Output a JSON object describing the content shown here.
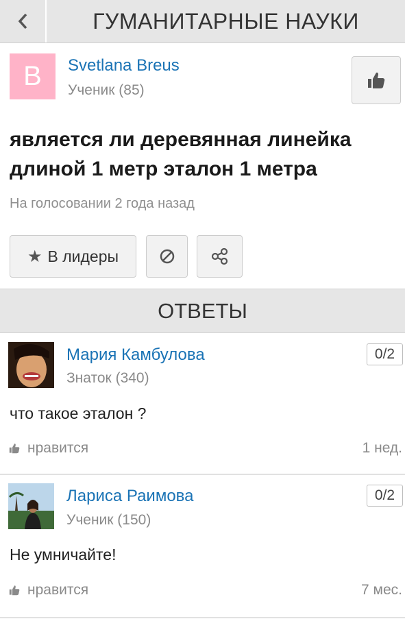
{
  "header": {
    "back_icon": "chevron-left-icon",
    "title": "ГУМАНИТАРНЫЕ НАУКИ"
  },
  "question": {
    "author": {
      "avatar_letter": "B",
      "avatar_color": "#ffb3c8",
      "name": "Svetlana Breus",
      "rank": "Ученик (85)"
    },
    "like_icon": "thumbs-up-icon",
    "text": "является ли деревянная линейка длиной 1 метр эталон 1 метра",
    "status": "На голосовании 2 года назад",
    "actions": {
      "leaders_label": "В лидеры",
      "leaders_icon": "star-icon",
      "block_icon": "block-icon",
      "share_icon": "share-icon"
    }
  },
  "answers_title": "ОТВЕТЫ",
  "answers": [
    {
      "name": "Мария Камбулова",
      "rank": "Знаток (340)",
      "score": "0/2",
      "text": "что такое эталон ?",
      "like_label": "нравится",
      "time": "1 нед."
    },
    {
      "name": "Лариса Раимова",
      "rank": "Ученик (150)",
      "score": "0/2",
      "text": "Не умничайте!",
      "like_label": "нравится",
      "time": "7 мес."
    }
  ],
  "colors": {
    "link": "#1a73b5",
    "header_bg": "#e6e6e6",
    "muted": "#8a8a8a"
  }
}
